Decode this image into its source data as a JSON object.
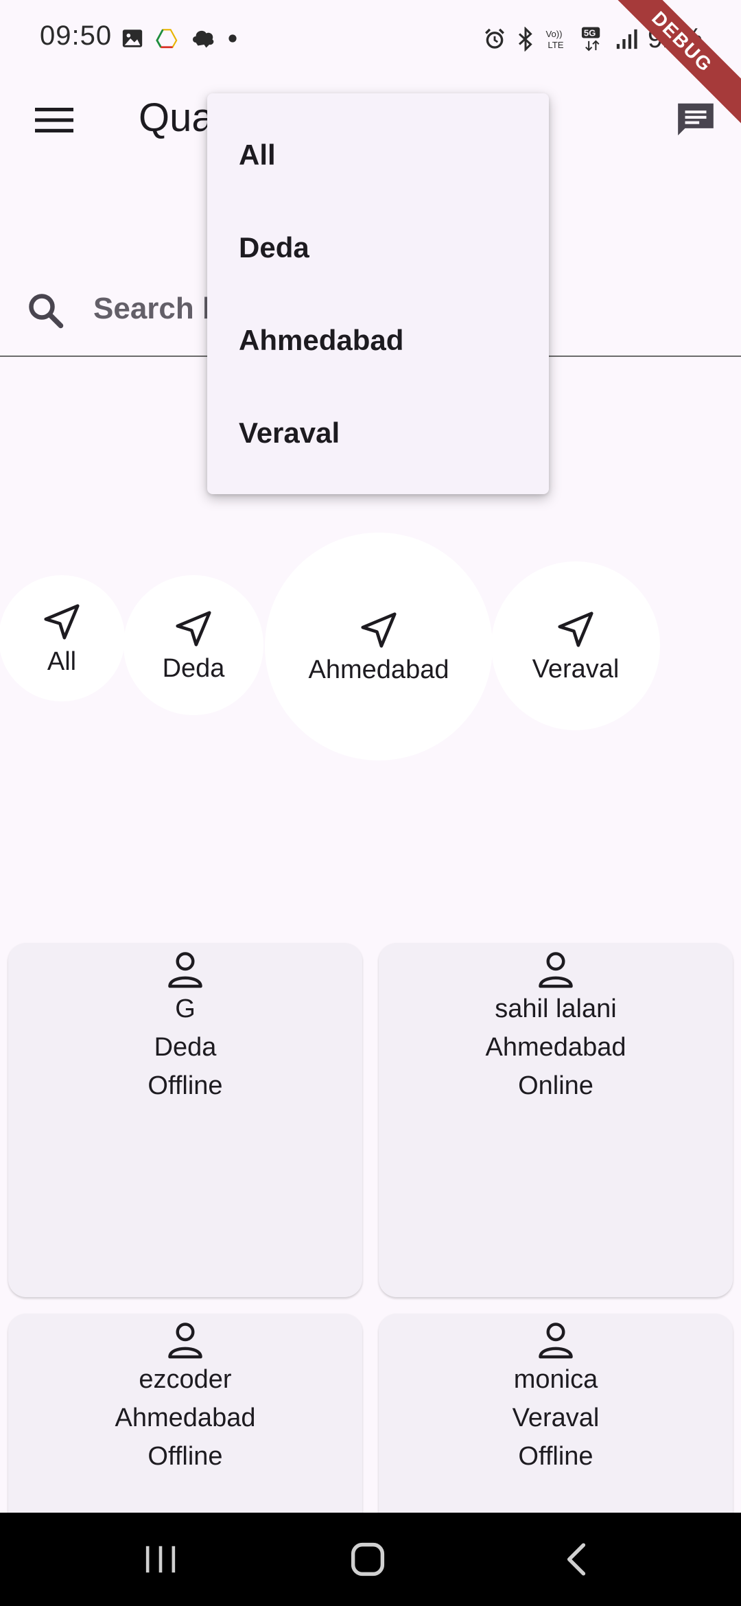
{
  "status_bar": {
    "time": "09:50",
    "battery": "92%",
    "icons_left": [
      "image-icon",
      "drive-icon",
      "notification-icon",
      "dot-icon"
    ],
    "icons_right": [
      "alarm-icon",
      "bluetooth-icon",
      "volte-icon",
      "5g-icon",
      "signal-icon"
    ]
  },
  "debug_banner": "DEBUG",
  "app_bar": {
    "title": "Qua",
    "menu_icon": "hamburger-menu-icon",
    "chat_icon": "chat-icon"
  },
  "search": {
    "placeholder": "Search b"
  },
  "dropdown": {
    "items": [
      "All",
      "Deda",
      "Ahmedabad",
      "Veraval"
    ]
  },
  "locations": [
    {
      "label": "All",
      "icon": "navigation-arrow-icon"
    },
    {
      "label": "Deda",
      "icon": "navigation-arrow-icon"
    },
    {
      "label": "Ahmedabad",
      "icon": "navigation-arrow-icon"
    },
    {
      "label": "Veraval",
      "icon": "navigation-arrow-icon"
    }
  ],
  "users": [
    {
      "name": "G",
      "city": "Deda",
      "status": "Offline"
    },
    {
      "name": "sahil lalani",
      "city": "Ahmedabad",
      "status": "Online"
    },
    {
      "name": "ezcoder",
      "city": "Ahmedabad",
      "status": "Offline"
    },
    {
      "name": "monica",
      "city": "Veraval",
      "status": "Offline"
    }
  ],
  "colors": {
    "background": "#fcf7fd",
    "card": "#f3eff6",
    "offline": "#d9534f",
    "online": "#5aa95a",
    "debug": "#a63a3a"
  },
  "nav_bar": {
    "buttons": [
      "recents-icon",
      "home-icon",
      "back-icon"
    ]
  }
}
